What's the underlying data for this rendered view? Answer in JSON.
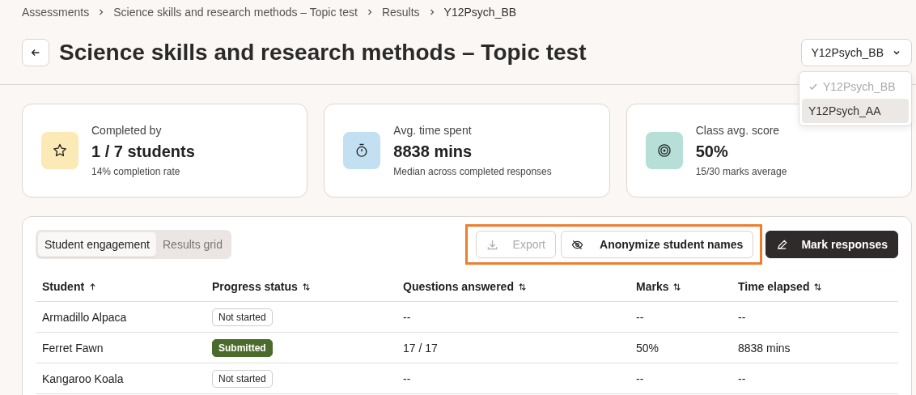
{
  "breadcrumb": [
    "Assessments",
    "Science skills and research methods – Topic test",
    "Results",
    "Y12Psych_BB"
  ],
  "title": "Science skills and research methods – Topic test",
  "class_select": {
    "value": "Y12Psych_BB",
    "expanded": true,
    "options": [
      {
        "label": "Y12Psych_BB",
        "selected": true,
        "highlighted": false
      },
      {
        "label": "Y12Psych_AA",
        "selected": false,
        "highlighted": true
      }
    ]
  },
  "stats": [
    {
      "kind": "star",
      "label": "Completed by",
      "value": "1 / 7 students",
      "sub": "14% completion rate",
      "color": "#fbeab5"
    },
    {
      "kind": "timer",
      "label": "Avg. time spent",
      "value": "8838 mins",
      "sub": "Median across completed responses",
      "color": "#c3e0f3"
    },
    {
      "kind": "target",
      "label": "Class avg. score",
      "value": "50%",
      "sub": "15/30 marks average",
      "color": "#b6dfd8"
    }
  ],
  "tabs": [
    {
      "label": "Student engagement",
      "selected": true
    },
    {
      "label": "Results grid",
      "selected": false
    }
  ],
  "actions": [
    {
      "kind": "export",
      "label": "Export",
      "disabled": true,
      "highlighted": true
    },
    {
      "kind": "anonymize",
      "label": "Anonymize student names",
      "disabled": false,
      "highlighted": true
    },
    {
      "kind": "mark",
      "label": "Mark responses",
      "disabled": false,
      "highlighted": false
    }
  ],
  "table": {
    "columns": [
      {
        "label": "Student",
        "kind": "asc"
      },
      {
        "label": "Progress status",
        "kind": "both"
      },
      {
        "label": "Questions answered",
        "kind": "both"
      },
      {
        "label": "Marks",
        "kind": "both"
      },
      {
        "label": "Time elapsed",
        "kind": "both"
      }
    ],
    "rows": [
      {
        "student": "Armadillo Alpaca",
        "status": "Not started",
        "kind": "outline",
        "questions": "--",
        "marks": "--",
        "time": "--"
      },
      {
        "student": "Ferret Fawn",
        "status": "Submitted",
        "kind": "filled",
        "questions": "17 / 17",
        "marks": "50%",
        "time": "8838 mins"
      },
      {
        "student": "Kangaroo Koala",
        "status": "Not started",
        "kind": "outline",
        "questions": "--",
        "marks": "--",
        "time": "--"
      }
    ]
  }
}
